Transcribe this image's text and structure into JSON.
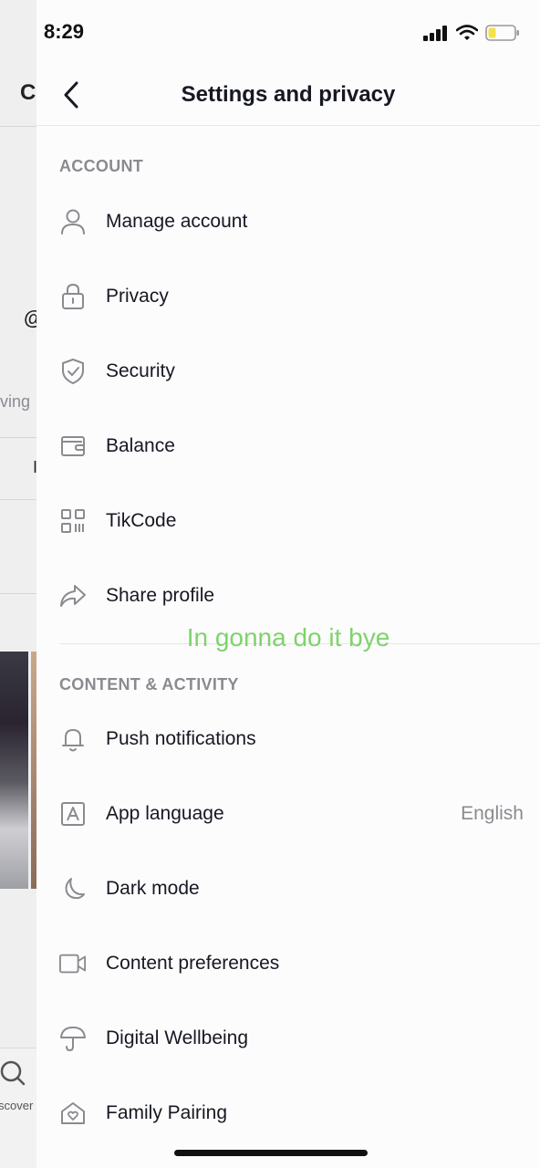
{
  "status_bar": {
    "time": "8:29",
    "icons": [
      "signal-icon",
      "wifi-icon",
      "battery-low-icon"
    ],
    "battery_color": "#f5e148"
  },
  "background_page": {
    "title_fragment": "C",
    "at_fragment": "@",
    "stat_fragment": "ving",
    "tab_fragment": "I",
    "nav_label_fragment": "scover"
  },
  "header": {
    "title": "Settings and privacy",
    "back_icon": "chevron-left-icon"
  },
  "sections": {
    "account": {
      "title": "ACCOUNT",
      "items": [
        {
          "label": "Manage account",
          "icon": "person-icon"
        },
        {
          "label": "Privacy",
          "icon": "lock-icon"
        },
        {
          "label": "Security",
          "icon": "shield-check-icon"
        },
        {
          "label": "Balance",
          "icon": "wallet-icon"
        },
        {
          "label": "TikCode",
          "icon": "qr-code-icon"
        },
        {
          "label": "Share profile",
          "icon": "share-arrow-icon"
        }
      ]
    },
    "content": {
      "title": "CONTENT & ACTIVITY",
      "items": [
        {
          "label": "Push notifications",
          "icon": "bell-icon"
        },
        {
          "label": "App language",
          "icon": "language-a-icon",
          "value": "English"
        },
        {
          "label": "Dark mode",
          "icon": "moon-icon"
        },
        {
          "label": "Content preferences",
          "icon": "video-camera-icon"
        },
        {
          "label": "Digital Wellbeing",
          "icon": "umbrella-icon"
        },
        {
          "label": "Family Pairing",
          "icon": "home-heart-icon"
        }
      ]
    }
  },
  "caption": {
    "text": "In gonna do it bye",
    "color": "#7ed36c"
  },
  "colors": {
    "text_primary": "#161823",
    "text_secondary": "#8a8b91",
    "panel_background": "#fdfcfc"
  }
}
